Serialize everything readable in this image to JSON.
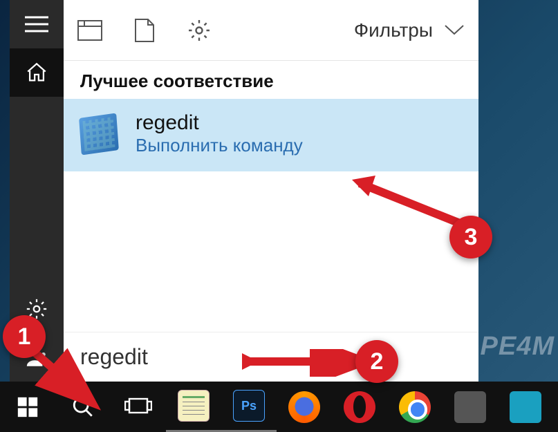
{
  "rail": {
    "menu_name": "menu",
    "home_name": "home",
    "settings_name": "settings",
    "account_name": "account"
  },
  "top": {
    "apps_name": "apps-tab",
    "docs_name": "documents-tab",
    "settings_name": "settings-tab",
    "filters_label": "Фильтры"
  },
  "results": {
    "header": "Лучшее соответствие",
    "items": [
      {
        "title": "regedit",
        "subtitle": "Выполнить команду"
      }
    ]
  },
  "search": {
    "value": "regedit",
    "placeholder": ""
  },
  "taskbar": {
    "start": "start",
    "search": "search",
    "taskview": "task-view",
    "apps": [
      "notepad",
      "photoshop",
      "firefox",
      "opera",
      "chrome",
      "app-6",
      "app-7"
    ]
  },
  "annotations": {
    "b1": "1",
    "b2": "2",
    "b3": "3"
  },
  "watermark": "PE4M"
}
